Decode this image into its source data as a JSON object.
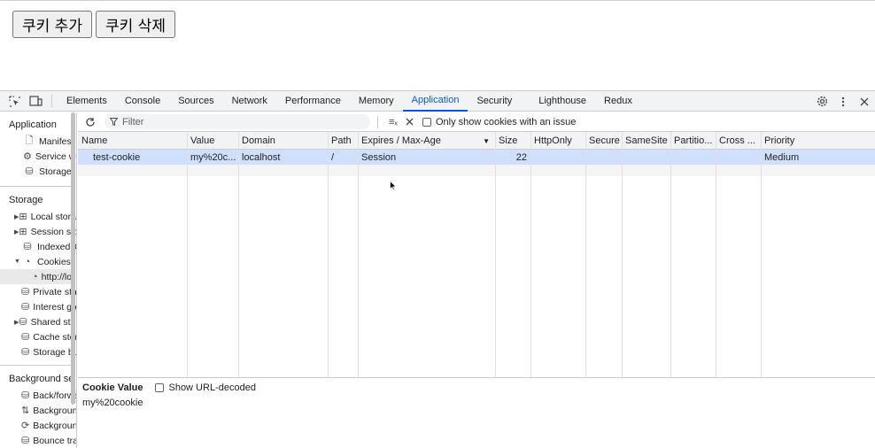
{
  "page": {
    "add_button": "쿠키 추가",
    "delete_button": "쿠키 삭제"
  },
  "devtools": {
    "tabs": [
      "Elements",
      "Console",
      "Sources",
      "Network",
      "Performance",
      "Memory",
      "Application",
      "Security",
      "Lighthouse",
      "Redux"
    ],
    "active_tab": "Application",
    "sidebar": {
      "application_header": "Application",
      "application_items": [
        "Manifest",
        "Service workers",
        "Storage"
      ],
      "storage_header": "Storage",
      "storage_items": [
        "Local storage",
        "Session storage",
        "IndexedDB",
        "Cookies",
        "http://localhost",
        "Private state tokens",
        "Interest groups",
        "Shared storage",
        "Cache storage",
        "Storage buckets"
      ],
      "background_header": "Background services",
      "background_items": [
        "Back/forward cache",
        "Background fetch",
        "Background sync",
        "Bounce tracking mitigations"
      ]
    },
    "filter": {
      "placeholder": "Filter",
      "only_issues_label": "Only show cookies with an issue"
    },
    "columns": [
      "Name",
      "Value",
      "Domain",
      "Path",
      "Expires / Max-Age",
      "Size",
      "HttpOnly",
      "Secure",
      "SameSite",
      "Partitio...",
      "Cross ...",
      "Priority"
    ],
    "rows": [
      {
        "name": "test-cookie",
        "value": "my%20c...",
        "domain": "localhost",
        "path": "/",
        "expires": "Session",
        "size": "22",
        "httponly": "",
        "secure": "",
        "samesite": "",
        "partition": "",
        "cross": "",
        "priority": "Medium"
      }
    ],
    "detail": {
      "title": "Cookie Value",
      "show_decoded_label": "Show URL-decoded",
      "value": "my%20cookie"
    }
  }
}
